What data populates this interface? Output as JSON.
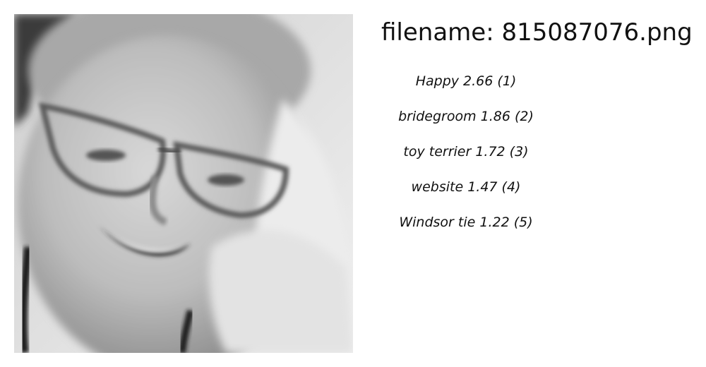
{
  "filename_text": "filename: 815087076.png",
  "predictions": [
    {
      "text": "Happy  2.66 (1)"
    },
    {
      "text": "bridegroom  1.86 (2)"
    },
    {
      "text": "toy terrier  1.72 (3)"
    },
    {
      "text": "website  1.47 (4)"
    },
    {
      "text": "Windsor tie  1.22 (5)"
    }
  ]
}
